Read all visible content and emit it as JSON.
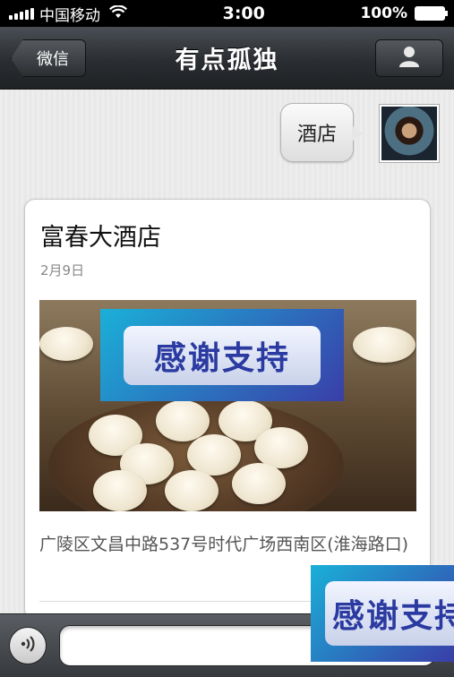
{
  "status_bar": {
    "carrier": "中国移动",
    "time": "3:00",
    "battery": "100%"
  },
  "nav": {
    "back_label": "微信",
    "title": "有点孤独",
    "profile_icon": "person-icon"
  },
  "chat": {
    "sent_message": "酒店",
    "card": {
      "title": "富春大酒店",
      "date": "2月9日",
      "overlay_text": "感谢支持",
      "address": "广陵区文昌中路537号时代广场西南区(淮海路口)"
    }
  },
  "floating_banner": {
    "text": "感谢支持"
  },
  "input_bar": {
    "voice_icon": "voice-icon",
    "input_value": ""
  },
  "colors": {
    "nav_dark": "#2a2d31",
    "banner_blue": "#3a3ea8",
    "banner_cyan": "#1ab0d8"
  }
}
